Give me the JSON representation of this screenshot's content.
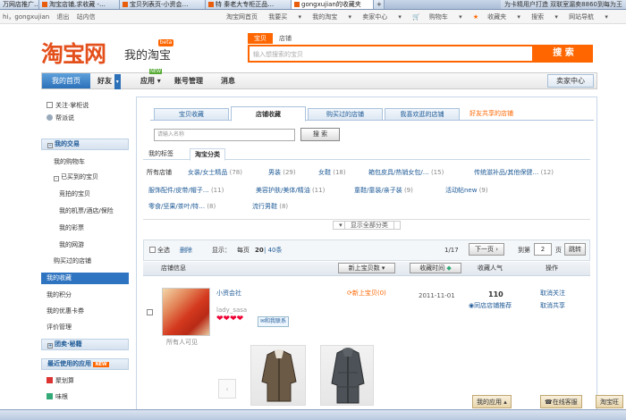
{
  "browser": {
    "tabs": [
      "万网店推广…",
      "淘宝店铺,求收藏 -…",
      "宝贝列表页-小资会…",
      "特 秦老大专柜正品…",
      "gongxujian的收藏夹",
      "+"
    ],
    "right_text": "为卡精用户打造 双联室漏卖8860到每为王"
  },
  "topnav": {
    "left": [
      "hi，gongxujian",
      "退出",
      "站内信"
    ],
    "right": [
      "淘宝网首页",
      "我要买",
      "我的淘宝",
      "卖家中心",
      "购物车",
      "收藏夹",
      "搜索",
      "网站导航"
    ]
  },
  "header": {
    "logo": "淘宝网",
    "logo_sub": "我的淘宝",
    "logo_badge": "beta",
    "search_tabs": [
      "宝贝",
      "店铺"
    ],
    "search_placeholder": "输入想搜索的宝贝",
    "search_button": "搜 索"
  },
  "menubar": {
    "items": [
      "我的首页",
      "好友",
      "应用",
      "账号管理",
      "消息"
    ],
    "new_badge": "NEW",
    "seller_center": "卖家中心"
  },
  "sidebar": {
    "top": [
      "关注·掌柜说",
      "帮派说"
    ],
    "sections": [
      {
        "head": "我的交易",
        "items": [
          "我的购物车",
          "已买到的宝贝",
          "竞拍的宝贝",
          "我的机票/酒店/保险",
          "我的彩票",
          "我的网游",
          "购买过的店铺",
          "我的收藏",
          "我的积分",
          "我的优惠卡券",
          "评价管理"
        ]
      },
      {
        "head": "团卖·秘籍",
        "items": []
      },
      {
        "head": "最近使用的应用",
        "items": [
          "聚划算",
          "味根"
        ]
      }
    ],
    "apps_badge": "NEW"
  },
  "content": {
    "tabs": [
      "宝贝收藏",
      "店铺收藏",
      "购买过的店铺",
      "我喜欢逛的店铺",
      "好友共享的店铺"
    ],
    "search_placeholder": "请输入名称",
    "search_button": "搜 索",
    "subtabs": [
      "我的标签",
      "淘宝分类"
    ],
    "categories": [
      {
        "name": "所有店铺",
        "count": ""
      },
      {
        "name": "女装/女士精品",
        "count": "(78)"
      },
      {
        "name": "男装",
        "count": "(29)"
      },
      {
        "name": "女鞋",
        "count": "(18)"
      },
      {
        "name": "箱包皮具/热销女包/…",
        "count": "(15)"
      },
      {
        "name": "传统滋补品/其他保健…",
        "count": "(12)"
      },
      {
        "name": "服饰配件/皮带/帽子…",
        "count": "(11)"
      },
      {
        "name": "美容护肤/美体/精油",
        "count": "(11)"
      },
      {
        "name": "童鞋/童装/亲子装",
        "count": "(9)"
      },
      {
        "name": "活动帖new",
        "count": "(9)"
      },
      {
        "name": "零食/坚果/茶叶/特…",
        "count": "(8)"
      },
      {
        "name": "流行男鞋",
        "count": "(8)"
      }
    ],
    "show_all": "显示全部分类",
    "toolbar": {
      "select_all": "全选",
      "delete": "删除",
      "display_label": "显示：",
      "per_page": "每页",
      "per_page_20": "20",
      "per_page_40": "40条",
      "page_info": "1/17",
      "next": "下一页",
      "goto_label": "到第",
      "goto_value": "2",
      "page_suffix": "页",
      "goto_btn": "跳转"
    },
    "headers": [
      "店铺信息",
      "新上宝贝数",
      "收藏时间",
      "收藏人气",
      "操作"
    ],
    "row": {
      "shop_name": "小资会社",
      "seller": "lady_sasa",
      "hearts": "❤❤❤❤",
      "contact": "和我联系",
      "new_items": "新上宝贝(0)",
      "date": "2011-11-01",
      "popularity": "110",
      "same_shop": "同店店铺推荐",
      "cancel": "取消关注",
      "share": "取消共享",
      "visibility": "所有人可见"
    }
  },
  "taskbar": {
    "items": [
      "我的应用",
      "在线客服",
      "淘宝旺"
    ]
  },
  "colors": {
    "brand": "#ff6600",
    "link": "#1e5a96",
    "accent_blue": "#2f74c0"
  }
}
